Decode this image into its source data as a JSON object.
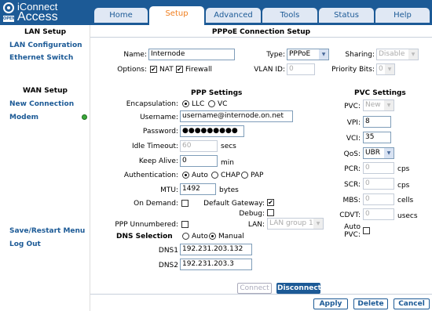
{
  "brand": {
    "line1": "iConnect",
    "line2": "Access",
    "badge": "OPEN"
  },
  "tabs": [
    {
      "label": "Home"
    },
    {
      "label": "Setup"
    },
    {
      "label": "Advanced"
    },
    {
      "label": "Tools"
    },
    {
      "label": "Status"
    },
    {
      "label": "Help"
    }
  ],
  "sidebar": {
    "lan_header": "LAN Setup",
    "lan_config": "LAN Configuration",
    "ethernet_switch": "Ethernet Switch",
    "wan_header": "WAN Setup",
    "new_connection": "New Connection",
    "modem": "Modem",
    "save_restart": "Save/Restart Menu",
    "logout": "Log Out"
  },
  "page": {
    "title": "PPPoE Connection Setup"
  },
  "conn": {
    "name_label": "Name:",
    "name_value": "Internode",
    "type_label": "Type:",
    "type_value": "PPPoE",
    "sharing_label": "Sharing:",
    "sharing_value": "Disable",
    "options_label": "Options:",
    "nat_label": "NAT",
    "firewall_label": "Firewall",
    "vlan_label": "VLAN ID:",
    "vlan_value": "0",
    "priority_label": "Priority Bits:",
    "priority_value": "0"
  },
  "ppp": {
    "header": "PPP Settings",
    "encap_label": "Encapsulation:",
    "encap_llc": "LLC",
    "encap_vc": "VC",
    "username_label": "Username:",
    "username_value": "username@internode.on.net",
    "password_label": "Password:",
    "password_value": "●●●●●●●●●",
    "idle_label": "Idle Timeout:",
    "idle_value": "60",
    "idle_unit": "secs",
    "keepalive_label": "Keep Alive:",
    "keepalive_value": "0",
    "keepalive_unit": "min",
    "auth_label": "Authentication:",
    "auth_auto": "Auto",
    "auth_chap": "CHAP",
    "auth_pap": "PAP",
    "mtu_label": "MTU:",
    "mtu_value": "1492",
    "mtu_unit": "bytes",
    "ondemand_label": "On Demand:",
    "defgw_label": "Default Gateway:",
    "debug_label": "Debug:",
    "unnumbered_label": "PPP Unnumbered:",
    "lan_label": "LAN:",
    "lan_value": "LAN group 1",
    "dns_header": "DNS Selection",
    "dns_auto": "Auto",
    "dns_manual": "Manual",
    "dns1_label": "DNS1",
    "dns1_value": "192.231.203.132",
    "dns2_label": "DNS2",
    "dns2_value": "192.231.203.3"
  },
  "pvc": {
    "header": "PVC Settings",
    "pvc_label": "PVC:",
    "pvc_value": "New",
    "vpi_label": "VPI:",
    "vpi_value": "8",
    "vci_label": "VCI:",
    "vci_value": "35",
    "qos_label": "QoS:",
    "qos_value": "UBR",
    "pcr_label": "PCR:",
    "pcr_value": "0",
    "pcr_unit": "cps",
    "scr_label": "SCR:",
    "scr_value": "0",
    "scr_unit": "cps",
    "mbs_label": "MBS:",
    "mbs_value": "0",
    "mbs_unit": "cells",
    "cdvt_label": "CDVT:",
    "cdvt_value": "0",
    "cdvt_unit": "usecs",
    "autopvc_label1": "Auto",
    "autopvc_label2": "PVC:"
  },
  "actions": {
    "connect": "Connect",
    "disconnect": "Disconnect",
    "apply": "Apply",
    "delete": "Delete",
    "cancel": "Cancel"
  },
  "colors": {
    "brand": "#1c5a96",
    "active_tab": "#f07e1e",
    "status_dot": "#3aa93a"
  }
}
